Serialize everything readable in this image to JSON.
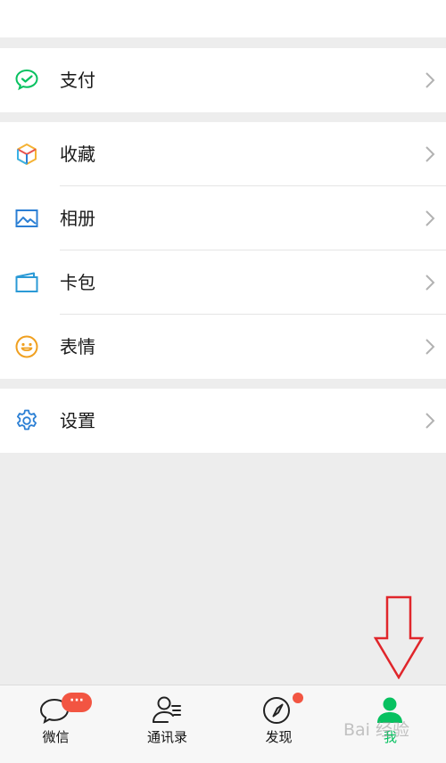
{
  "menu": {
    "group1": [
      {
        "label": "支付",
        "icon": "wechat-pay-icon"
      }
    ],
    "group2": [
      {
        "label": "收藏",
        "icon": "favorites-cube-icon"
      },
      {
        "label": "相册",
        "icon": "photo-album-icon"
      },
      {
        "label": "卡包",
        "icon": "card-wallet-icon"
      },
      {
        "label": "表情",
        "icon": "smiley-icon"
      }
    ],
    "group3": [
      {
        "label": "设置",
        "icon": "gear-icon"
      }
    ]
  },
  "tabbar": {
    "chats_label": "微信",
    "chats_badge": "···",
    "contacts_label": "通讯录",
    "discover_label": "发现",
    "me_label": "我"
  },
  "colors": {
    "accent_green": "#07c160",
    "badge_red": "#f25542",
    "icon_blue": "#2b7fd4",
    "annotation_red": "#e0262b"
  },
  "watermark": "Bai 经验"
}
